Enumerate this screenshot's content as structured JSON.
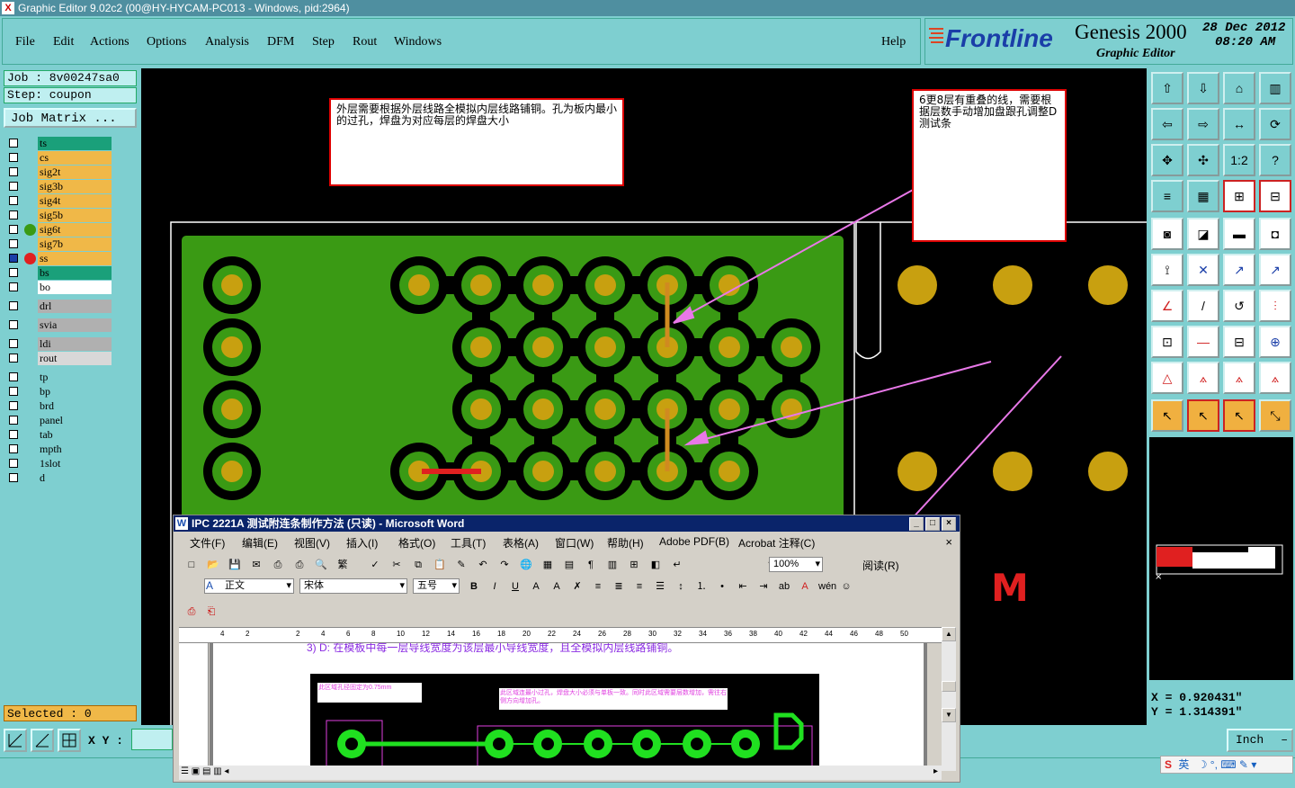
{
  "window": {
    "title": "Graphic Editor 9.02c2 (00@HY-HYCAM-PC013 - Windows, pid:2964)"
  },
  "menu": [
    "File",
    "Edit",
    "Actions",
    "Options",
    "Analysis",
    "DFM",
    "Step",
    "Rout",
    "Windows"
  ],
  "help_label": "Help",
  "brand": {
    "logo": "Frontline",
    "product": "Genesis 2000",
    "subtitle": "Graphic Editor",
    "date": "28 Dec 2012",
    "time": "08:20 AM"
  },
  "job": {
    "job_label": "Job : 8v00247sa0",
    "step_label": "Step: coupon",
    "matrix_button": "Job Matrix ..."
  },
  "layers": [
    {
      "name": "ts",
      "bg": "#1aa07a"
    },
    {
      "name": "cs",
      "bg": "#f0b848"
    },
    {
      "name": "sig2t",
      "bg": "#f0b848"
    },
    {
      "name": "sig3b",
      "bg": "#f0b848"
    },
    {
      "name": "sig4t",
      "bg": "#f0b848"
    },
    {
      "name": "sig5b",
      "bg": "#f0b848"
    },
    {
      "name": "sig6t",
      "bg": "#f0b848"
    },
    {
      "name": "sig7b",
      "bg": "#f0b848"
    },
    {
      "name": "ss",
      "bg": "#f0b848"
    },
    {
      "name": "bs",
      "bg": "#1aa07a"
    },
    {
      "name": "bo",
      "bg": "#ffffff"
    },
    {
      "name": "drl",
      "bg": "#b0b0b0"
    },
    {
      "name": "svia",
      "bg": "#b0b0b0"
    },
    {
      "name": "ldi",
      "bg": "#b0b0b0"
    },
    {
      "name": "rout",
      "bg": "#d8d8d8"
    },
    {
      "name": "tp",
      "bg": "#7ecfd0"
    },
    {
      "name": "bp",
      "bg": "#7ecfd0"
    },
    {
      "name": "brd",
      "bg": "#7ecfd0"
    },
    {
      "name": "panel",
      "bg": "#7ecfd0"
    },
    {
      "name": "tab",
      "bg": "#7ecfd0"
    },
    {
      "name": "mpth",
      "bg": "#7ecfd0"
    },
    {
      "name": "1slot",
      "bg": "#7ecfd0"
    },
    {
      "name": "d",
      "bg": "#7ecfd0"
    }
  ],
  "selected_label": "Selected : 0",
  "xy_label": "X Y :",
  "coords": {
    "x": "X = 0.920431\"",
    "y": "Y = 1.314391\""
  },
  "units": "Inch",
  "notes": {
    "top": "外层需要根据外层线路全模拟内层线路铺铜。孔为板内最小的过孔，焊盘为对应每层的焊盘大小",
    "right": "6更8层有重叠的线，需要根据层数手动增加盘跟孔调整D测试条"
  },
  "canvas_letter": "M",
  "word": {
    "title": "IPC 2221A 测试附连条制作方法 (只读) - Microsoft Word",
    "menu": [
      "文件(F)",
      "编辑(E)",
      "视图(V)",
      "插入(I)",
      "格式(O)",
      "工具(T)",
      "表格(A)",
      "窗口(W)",
      "帮助(H)",
      "Adobe PDF(B)",
      "Acrobat 注释(C)"
    ],
    "zoom": "100%",
    "read_label": "阅读(R)",
    "style": "正文",
    "font": "宋体",
    "size": "五号",
    "ruler": [
      "4",
      "2",
      "",
      "2",
      "4",
      "6",
      "8",
      "10",
      "12",
      "14",
      "16",
      "18",
      "20",
      "22",
      "24",
      "26",
      "28",
      "30",
      "32",
      "34",
      "36",
      "38",
      "40",
      "42",
      "44",
      "46",
      "48",
      "50"
    ],
    "body_line": "3) D: 在模板中每一层导线宽度为该层最小导线宽度，且全模拟内层线路铺铜。",
    "img_note1": "此区域孔径固定为0.75mm",
    "img_note2": "此区域连最小过孔，焊盘大小必须与单板一致。同时此区域需要层数增加，需往右侧方向增加孔。"
  },
  "taskbar": {
    "ime": "英"
  }
}
